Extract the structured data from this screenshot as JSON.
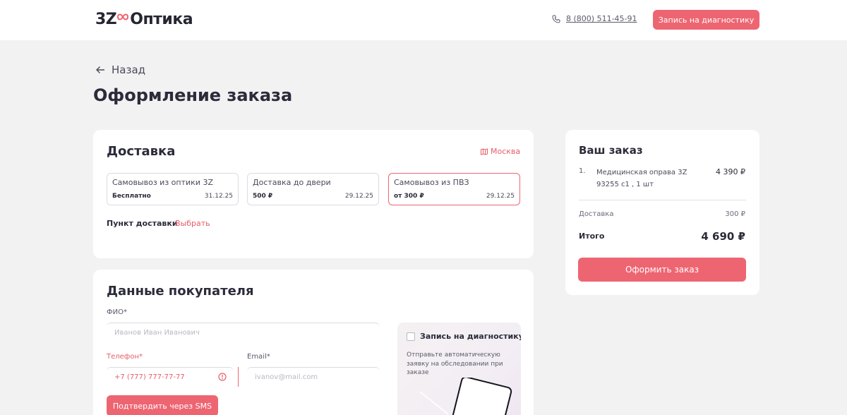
{
  "colors": {
    "accent": "#ee6572",
    "text": "#2b2b3a",
    "background": "#f2f2f3",
    "card": "#ffffff"
  },
  "header": {
    "logo_mark": "3Z",
    "logo_text": "Оптика",
    "phone": "8 (800) 511-45-91",
    "cta_label": "Запись на диагностику"
  },
  "nav": {
    "back_label": "Назад"
  },
  "page": {
    "title": "Оформление заказа"
  },
  "delivery": {
    "title": "Доставка",
    "city": "Москва",
    "options": [
      {
        "name": "Самовывоз из оптики 3Z",
        "price": "Бесплатно",
        "date": "31.12.25",
        "selected": false
      },
      {
        "name": "Доставка до двери",
        "price": "500 ₽",
        "date": "29.12.25",
        "selected": false
      },
      {
        "name": "Самовывоз из ПВЗ",
        "price": "от 300 ₽",
        "date": "29.12.25",
        "selected": true
      }
    ],
    "point_label": "Пункт доставки",
    "point_action": "Выбрать"
  },
  "buyer": {
    "title": "Данные покупателя",
    "fio_label": "ФИО*",
    "fio_placeholder": "Иванов Иван Иванович",
    "phone_label": "Телефон*",
    "phone_value": "+7 (777) 777-77-77",
    "email_label": "Email*",
    "email_placeholder": "ivanov@mail.com",
    "sms_button": "Подтвердить через SMS",
    "promo": {
      "title": "Запись на диагностику",
      "text": "Отправьте автоматическую заявку на обследовании при заказе",
      "checked": false
    }
  },
  "order": {
    "title": "Ваш заказ",
    "items": [
      {
        "index": "1.",
        "name": "Медицинская оправа 3Z 93255 c1 , 1 шт",
        "price": "4 390 ₽"
      }
    ],
    "delivery_label": "Доставка",
    "delivery_value": "300 ₽",
    "total_label": "Итого",
    "total_value": "4 690 ₽",
    "submit_label": "Оформить заказ"
  },
  "icons": [
    "infinity-logo-icon",
    "phone-icon",
    "arrow-left-icon",
    "map-icon",
    "error-icon",
    "checkbox-icon",
    "tablet-illustration"
  ]
}
